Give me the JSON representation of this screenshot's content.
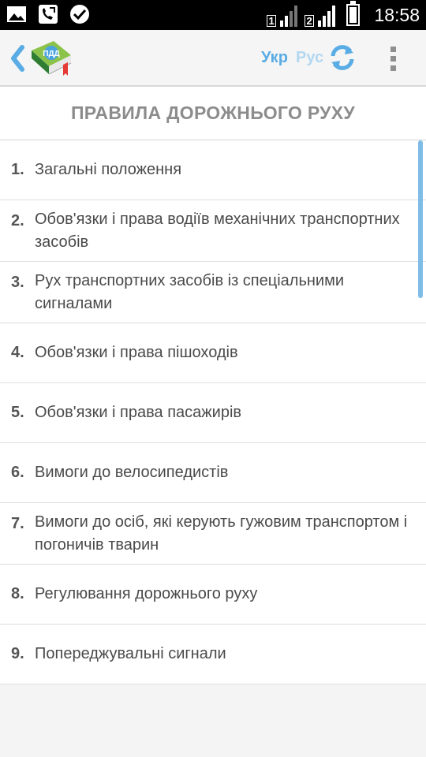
{
  "status_bar": {
    "time": "18:58",
    "sim1_label": "1",
    "sim2_label": "2",
    "icons": [
      "gallery-icon",
      "phone-missed-icon",
      "check-icon",
      "battery-icon"
    ]
  },
  "app_bar": {
    "lang_ukr": "Укр",
    "lang_rus": "Рус",
    "logo_text": "ПДД"
  },
  "page": {
    "title": "ПРАВИЛА ДОРОЖНЬОГО РУХУ"
  },
  "sections": [
    {
      "num": "1.",
      "title": "Загальні положення"
    },
    {
      "num": "2.",
      "title": "Обов'язки і права водіїв механічних транспортних засобів"
    },
    {
      "num": "3.",
      "title": "Рух транспортних засобів із спеціальними сигналами"
    },
    {
      "num": "4.",
      "title": "Обов'язки і права пішоходів"
    },
    {
      "num": "5.",
      "title": "Обов'язки і права пасажирів"
    },
    {
      "num": "6.",
      "title": "Вимоги до велосипедистів"
    },
    {
      "num": "7.",
      "title": "Вимоги до осіб, які керують гужовим транспортом і погоничів тварин"
    },
    {
      "num": "8.",
      "title": "Регулювання дорожнього руху"
    },
    {
      "num": "9.",
      "title": "Попереджувальні сигнали"
    }
  ],
  "colors": {
    "accent": "#5aace4",
    "accent_light": "#b3d8f2",
    "title_gray": "#8c8c8c"
  }
}
